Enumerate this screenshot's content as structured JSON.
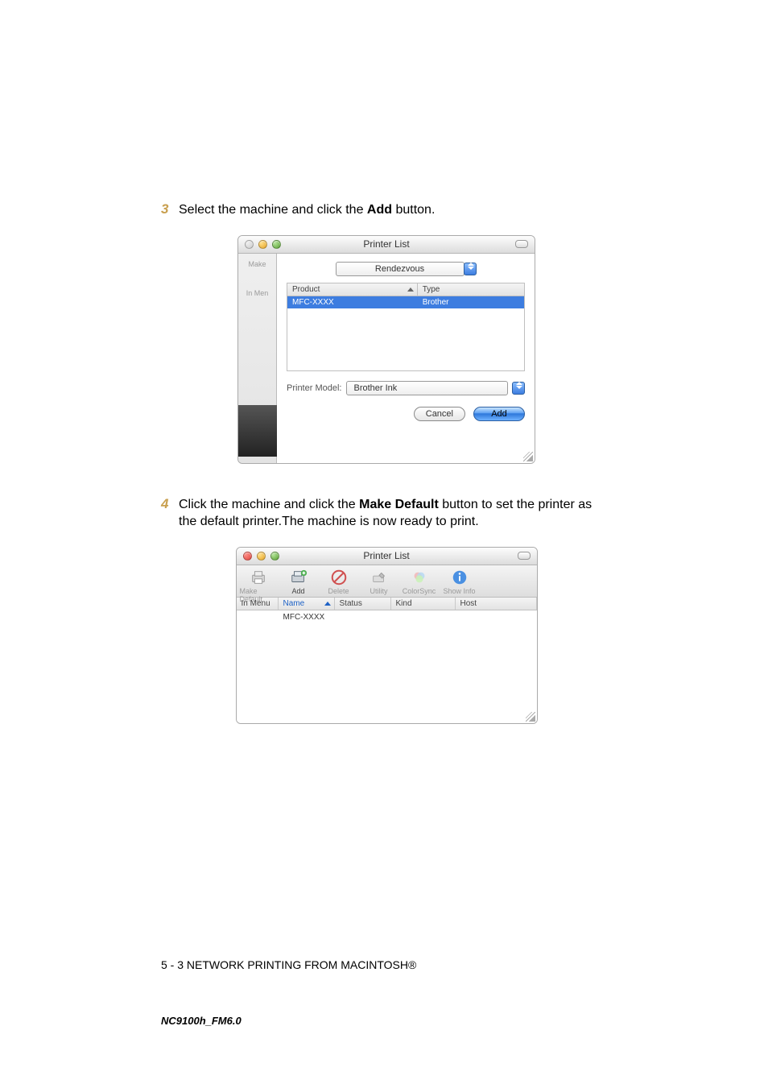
{
  "step3": {
    "num": "3",
    "prefix": "Select the machine and click the ",
    "bold": "Add",
    "suffix": " button."
  },
  "step4": {
    "num": "4",
    "prefix": "Click the machine and click the ",
    "bold": "Make Default",
    "suffix": " button to set the printer as the default printer.The machine is now ready to print."
  },
  "dlg1": {
    "title": "Printer List",
    "side": {
      "make": "Make",
      "inmenu": "In Men"
    },
    "popup": "Rendezvous",
    "cols": {
      "product": "Product",
      "type": "Type"
    },
    "row": {
      "product": "MFC-XXXX",
      "type": "Brother"
    },
    "pm_label": "Printer Model:",
    "pm_value": "Brother Ink",
    "cancel": "Cancel",
    "add": "Add"
  },
  "dlg2": {
    "title": "Printer List",
    "toolbar": {
      "make_default": "Make Default",
      "add": "Add",
      "delete": "Delete",
      "utility": "Utility",
      "colorsync": "ColorSync",
      "showinfo": "Show Info"
    },
    "cols": {
      "inmenu": "In Menu",
      "name": "Name",
      "status": "Status",
      "kind": "Kind",
      "host": "Host"
    },
    "row": {
      "name": "MFC-XXXX"
    }
  },
  "footer": "5 - 3 NETWORK PRINTING FROM MACINTOSH®",
  "footid": "NC9100h_FM6.0"
}
